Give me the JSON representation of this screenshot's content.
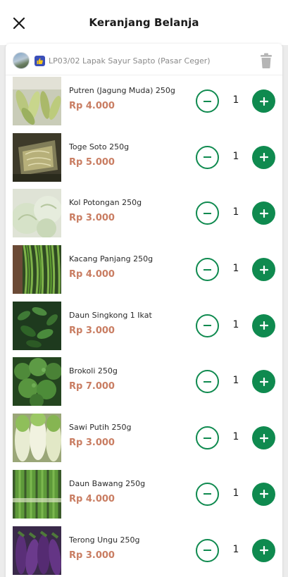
{
  "header": {
    "title": "Keranjang Belanja",
    "close_icon": "close-icon"
  },
  "store": {
    "name": "LP03/02 Lapak Sayur Sapto (Pasar Ceger)",
    "badge_icon": "thumbs-up-icon",
    "delete_icon": "trash-icon"
  },
  "colors": {
    "accent": "#0f8a4f",
    "price": "#c97d62"
  },
  "items": [
    {
      "name": "Putren (Jagung Muda) 250g",
      "price": "Rp 4.000",
      "qty": "1",
      "image": "baby-corn"
    },
    {
      "name": "Toge Soto 250g",
      "price": "Rp 5.000",
      "qty": "1",
      "image": "bean-sprouts"
    },
    {
      "name": "Kol Potongan 250g",
      "price": "Rp 3.000",
      "qty": "1",
      "image": "cabbage"
    },
    {
      "name": "Kacang Panjang 250g",
      "price": "Rp 4.000",
      "qty": "1",
      "image": "long-beans"
    },
    {
      "name": "Daun Singkong 1 Ikat",
      "price": "Rp 3.000",
      "qty": "1",
      "image": "cassava-leaves"
    },
    {
      "name": "Brokoli 250g",
      "price": "Rp 7.000",
      "qty": "1",
      "image": "broccoli"
    },
    {
      "name": "Sawi Putih 250g",
      "price": "Rp 3.000",
      "qty": "1",
      "image": "napa-cabbage"
    },
    {
      "name": "Daun Bawang 250g",
      "price": "Rp 4.000",
      "qty": "1",
      "image": "scallion"
    },
    {
      "name": "Terong Ungu 250g",
      "price": "Rp 3.000",
      "qty": "1",
      "image": "eggplant"
    }
  ]
}
